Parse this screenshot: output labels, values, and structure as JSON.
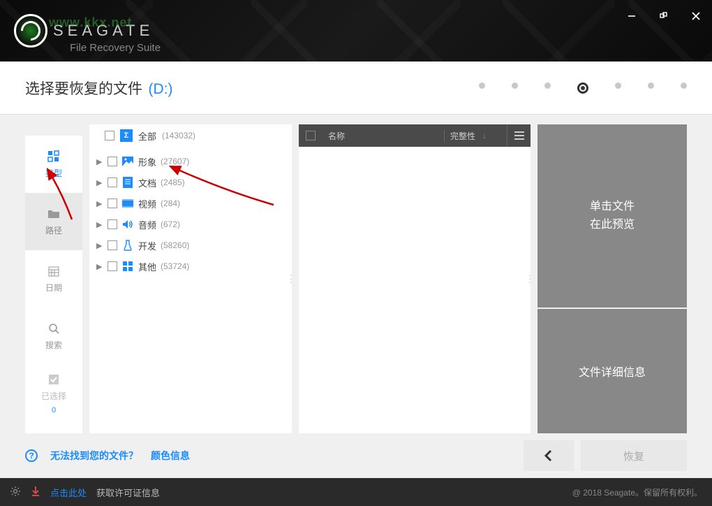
{
  "app": {
    "brand": "SEAGATE",
    "subtitle": "File Recovery Suite",
    "watermark": "www.kkx.net"
  },
  "header": {
    "title": "选择要恢复的文件",
    "drive": "(D:)",
    "active_step": 3
  },
  "sidebar": {
    "type": "类型",
    "path": "路径",
    "date": "日期",
    "search": "搜索",
    "selected": "已选择",
    "selected_count": "0"
  },
  "tree": {
    "all": {
      "label": "全部",
      "count": "(143032)"
    },
    "items": [
      {
        "label": "形象",
        "count": "(27607)",
        "icon": "image"
      },
      {
        "label": "文档",
        "count": "(2485)",
        "icon": "document"
      },
      {
        "label": "视频",
        "count": "(284)",
        "icon": "video"
      },
      {
        "label": "音频",
        "count": "(672)",
        "icon": "audio"
      },
      {
        "label": "开发",
        "count": "(58260)",
        "icon": "dev"
      },
      {
        "label": "其他",
        "count": "(53724)",
        "icon": "other"
      }
    ]
  },
  "list": {
    "col_name": "名称",
    "col_integrity": "完整性"
  },
  "preview": {
    "line1": "单击文件",
    "line2": "在此预览",
    "details": "文件详细信息"
  },
  "footer": {
    "help_q": "无法找到您的文件？",
    "color_info": "颜色信息",
    "recover": "恢复"
  },
  "status": {
    "click_here": "点击此处",
    "license": "获取许可证信息",
    "copyright": "@ 2018 Seagate。保留所有权利。"
  }
}
